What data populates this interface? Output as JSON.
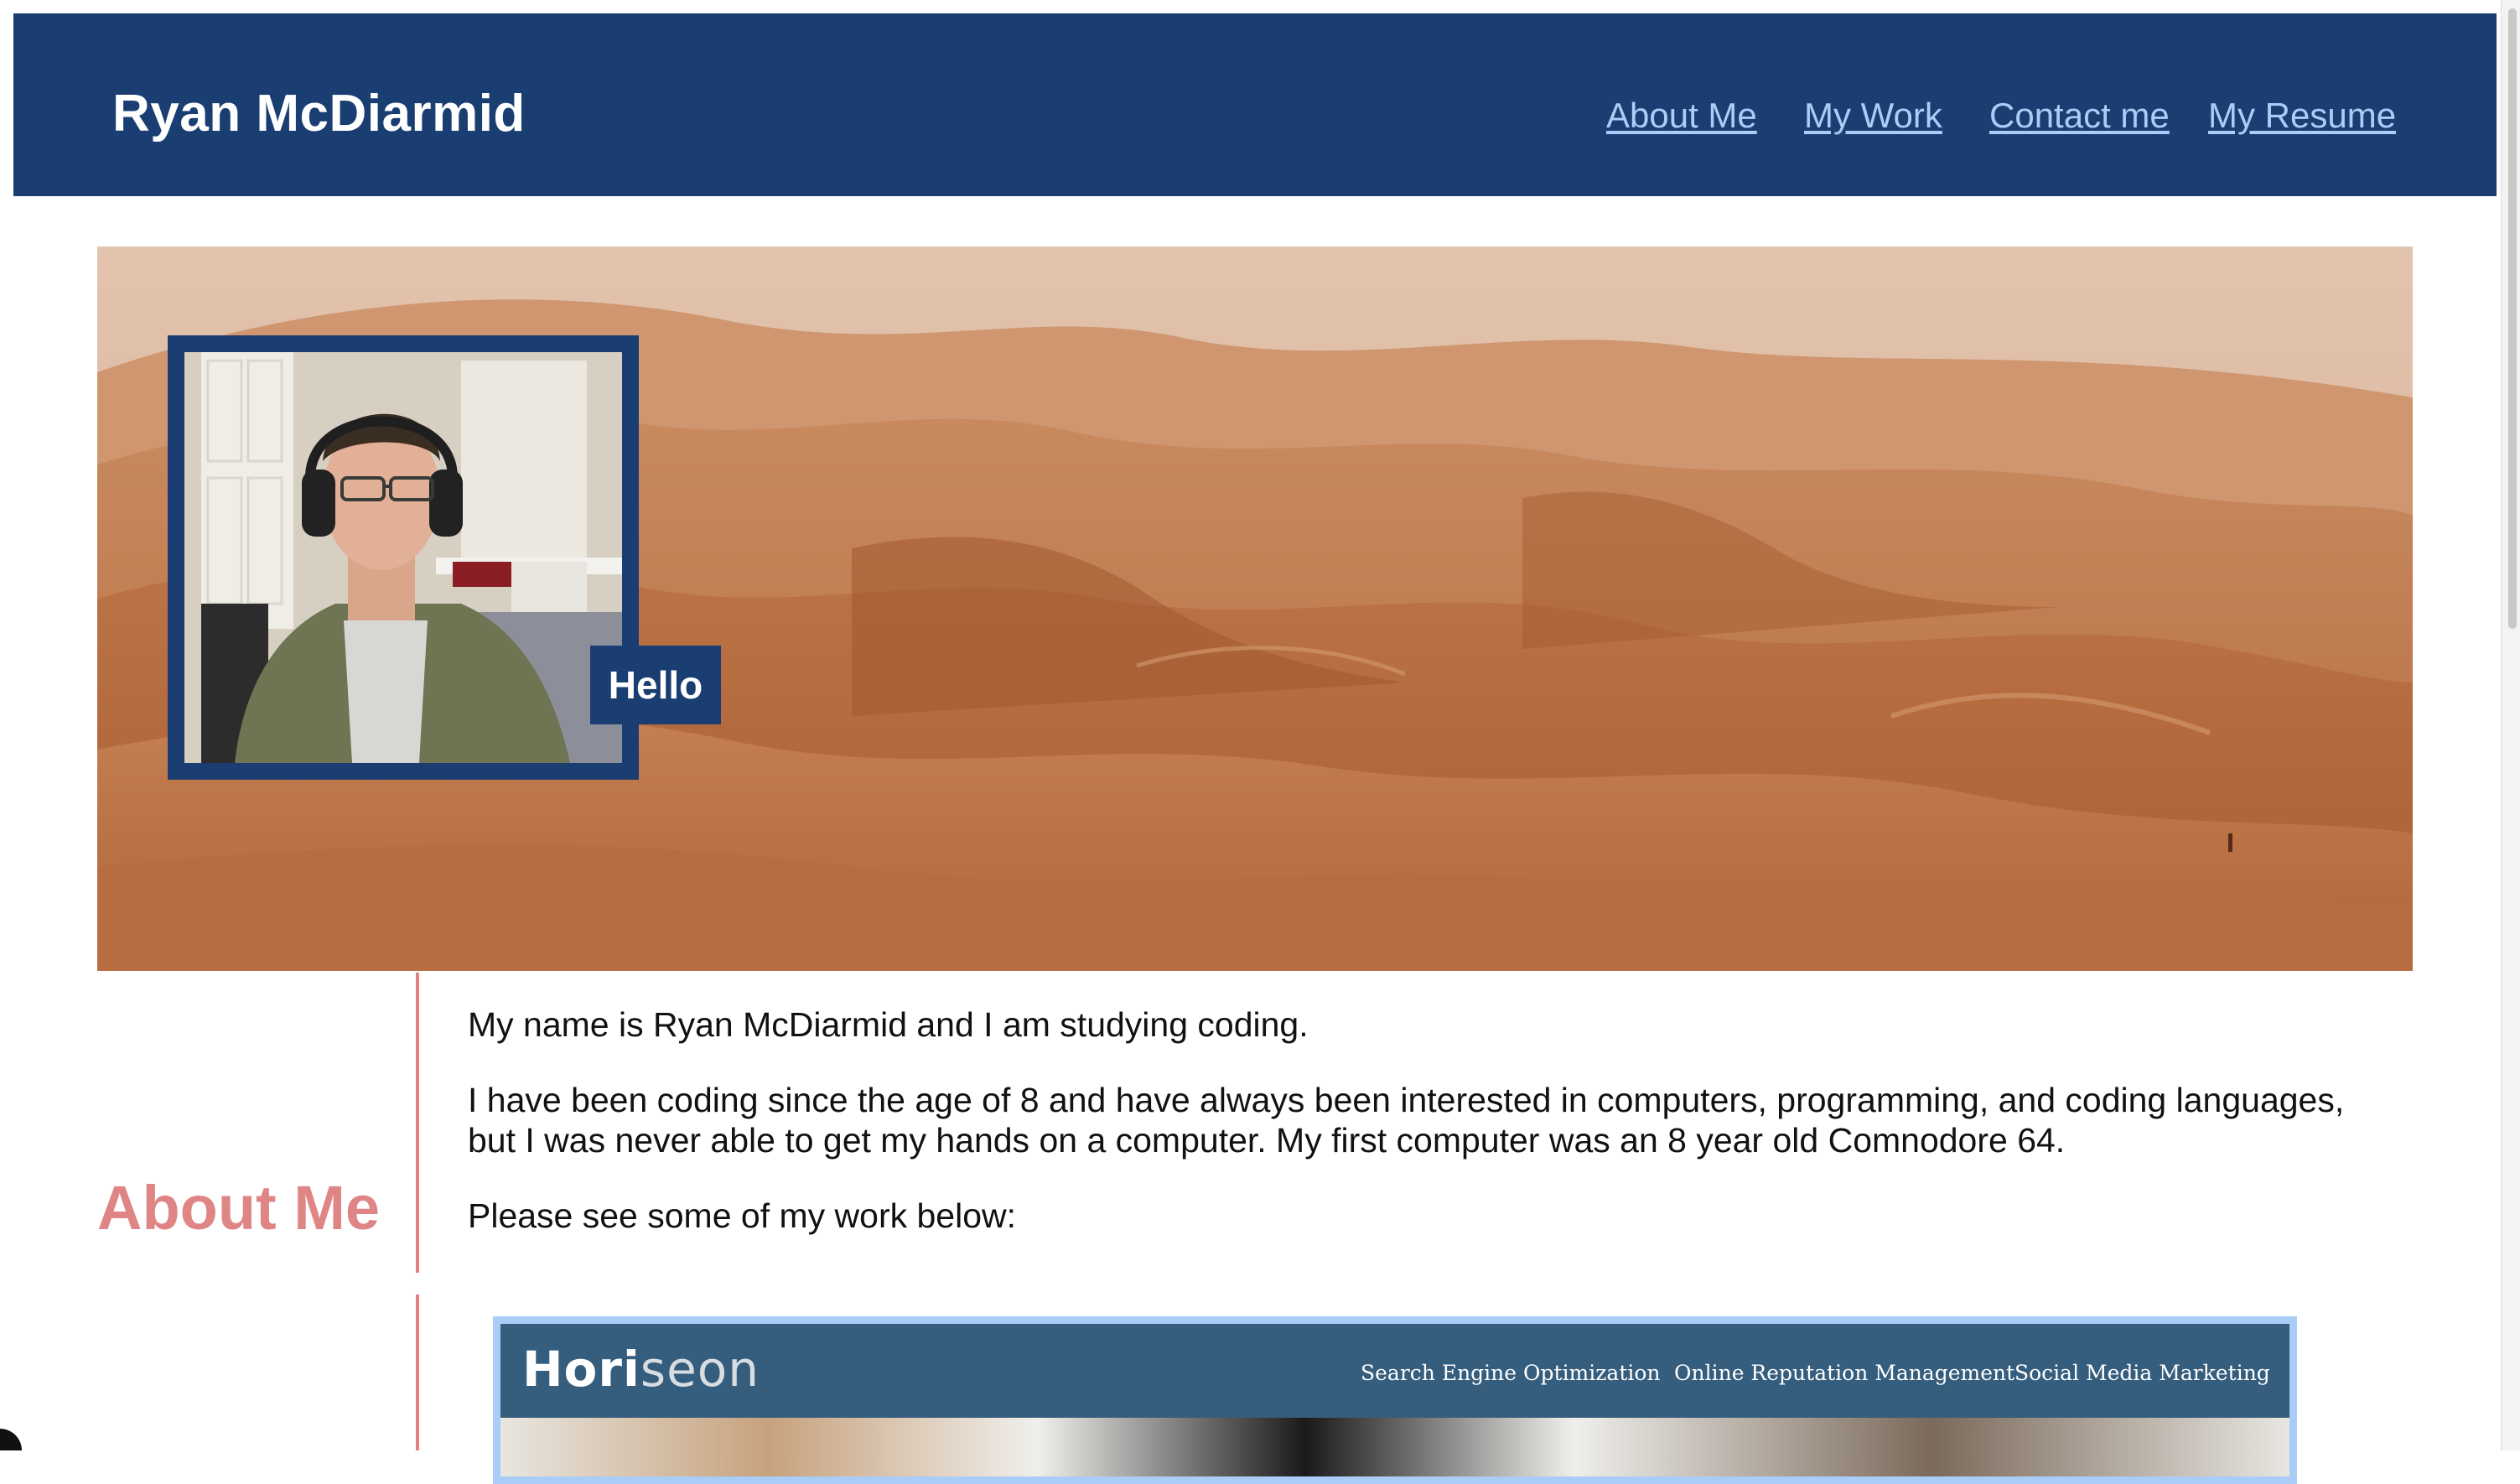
{
  "header": {
    "title": "Ryan McDiarmid",
    "nav": [
      {
        "label": "About Me"
      },
      {
        "label": "My Work"
      },
      {
        "label": "Contact me"
      },
      {
        "label": "My Resume"
      }
    ]
  },
  "hero": {
    "badge": "Hello",
    "image": "desert-dunes",
    "portrait": "profile-photo"
  },
  "about": {
    "heading": "About Me",
    "paragraphs": [
      "My name is Ryan McDiarmid and I am studying coding.",
      "I have been coding since the age of 8 and have always been interested in computers, programming, and coding languages, but I was never able to get my hands on a computer. My first computer was an 8 year old Comnodore 64.",
      "Please see some of my work below:"
    ]
  },
  "work": {
    "logo_main": "Hori",
    "logo_light": "seon",
    "links": [
      "Search Engine Optimization",
      "Online Reputation Management",
      "Social Media Marketing"
    ]
  },
  "colors": {
    "header_bg": "#1a3e72",
    "nav_link": "#a9cdf6",
    "accent": "#e08585"
  }
}
